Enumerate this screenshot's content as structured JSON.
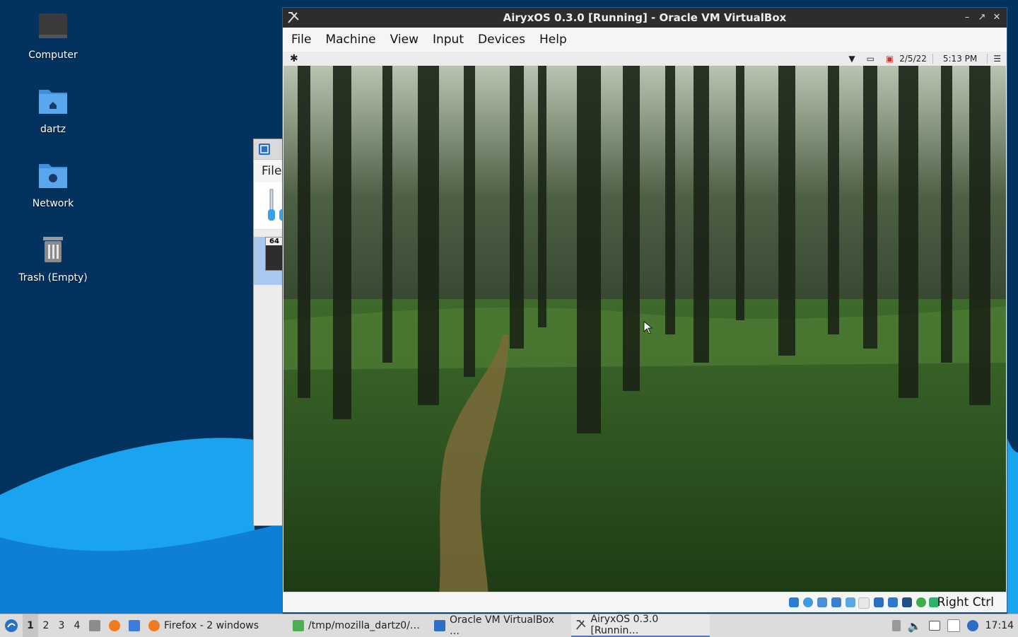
{
  "desktop": {
    "icons": [
      {
        "label": "Computer"
      },
      {
        "label": "dartz"
      },
      {
        "label": "Network"
      },
      {
        "label": "Trash (Empty)"
      }
    ]
  },
  "background_window": {
    "menu_first": "File",
    "badge": "64"
  },
  "vbox": {
    "title": "AiryxOS 0.3.0 [Running] - Oracle VM VirtualBox",
    "menu": [
      "File",
      "Machine",
      "View",
      "Input",
      "Devices",
      "Help"
    ],
    "guest": {
      "date": "2/5/22",
      "time": "5:13 PM"
    },
    "host_key": "Right Ctrl"
  },
  "taskbar": {
    "workspaces": [
      "1",
      "2",
      "3",
      "4"
    ],
    "active_workspace": "1",
    "tasks": [
      {
        "label": "Firefox - 2 windows"
      },
      {
        "label": "/tmp/mozilla_dartz0/…"
      },
      {
        "label": "Oracle VM VirtualBox …"
      },
      {
        "label": "AiryxOS 0.3.0 [Runnin…"
      }
    ],
    "clock": "17:14"
  },
  "colors": {
    "desktop_bg": "#04325f",
    "wave_light": "#1aa3ee",
    "wave_dark": "#0a5fb0",
    "accent": "#3b7ddd"
  }
}
